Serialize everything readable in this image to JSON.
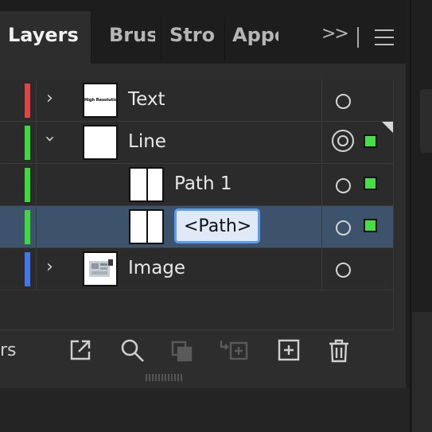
{
  "tabs": [
    {
      "label": "Layers",
      "active": true
    },
    {
      "label": "Brus",
      "active": false
    },
    {
      "label": "Strol",
      "active": false
    },
    {
      "label": "Appe",
      "active": false
    }
  ],
  "tab_overflow_label": ">>",
  "layers": [
    {
      "name": "Text",
      "color": "#e04444",
      "expander": "collapsed",
      "thumbnail_text": "High Resolution",
      "targeted": false,
      "has_selection": false,
      "selected": false
    },
    {
      "name": "Line",
      "color": "#3fd93f",
      "expander": "expanded",
      "targeted": true,
      "has_selection": true,
      "selected": false
    },
    {
      "name": "Path 1",
      "color": "#3fd93f",
      "indent": 1,
      "targeted": false,
      "has_selection": true,
      "selected": false
    },
    {
      "name": "<Path>",
      "color": "#3fd93f",
      "indent": 1,
      "editing": true,
      "targeted": false,
      "has_selection": true,
      "selected": true
    },
    {
      "name": "Image",
      "color": "#4477e8",
      "expander": "collapsed",
      "targeted": false,
      "has_selection": false,
      "selected": false
    }
  ],
  "footer": {
    "layer_count_label": "rs",
    "icons": [
      "export-icon",
      "locate-object-icon",
      "clipping-mask-icon",
      "move-to-layer-icon",
      "new-sublayer-icon",
      "delete-icon"
    ]
  },
  "colors": {
    "selection_row": "#3c536b",
    "selected_art": "#46e046",
    "edit_border": "#5b9bf2"
  }
}
